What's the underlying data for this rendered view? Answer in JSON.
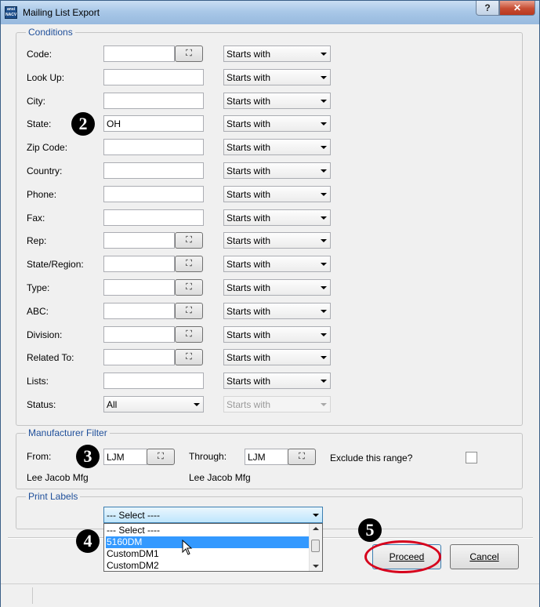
{
  "window": {
    "title": "Mailing List Export",
    "app_icon_text": "ansi NACV",
    "help_glyph": "?",
    "close_glyph": "✕"
  },
  "conditions": {
    "legend": "Conditions",
    "find_glyph": "⛶",
    "rows": [
      {
        "label": "Code:",
        "value": "",
        "has_find": true,
        "operator": "Starts with"
      },
      {
        "label": "Look Up:",
        "value": "",
        "has_find": false,
        "operator": "Starts with"
      },
      {
        "label": "City:",
        "value": "",
        "has_find": false,
        "operator": "Starts with"
      },
      {
        "label": "State:",
        "value": "OH",
        "has_find": false,
        "operator": "Starts with"
      },
      {
        "label": "Zip Code:",
        "value": "",
        "has_find": false,
        "operator": "Starts with"
      },
      {
        "label": "Country:",
        "value": "",
        "has_find": false,
        "operator": "Starts with"
      },
      {
        "label": "Phone:",
        "value": "",
        "has_find": false,
        "operator": "Starts with"
      },
      {
        "label": "Fax:",
        "value": "",
        "has_find": false,
        "operator": "Starts with"
      },
      {
        "label": "Rep:",
        "value": "",
        "has_find": true,
        "operator": "Starts with"
      },
      {
        "label": "State/Region:",
        "value": "",
        "has_find": true,
        "operator": "Starts with"
      },
      {
        "label": "Type:",
        "value": "",
        "has_find": true,
        "operator": "Starts with"
      },
      {
        "label": "ABC:",
        "value": "",
        "has_find": true,
        "operator": "Starts with"
      },
      {
        "label": "Division:",
        "value": "",
        "has_find": true,
        "operator": "Starts with"
      },
      {
        "label": "Related To:",
        "value": "",
        "has_find": true,
        "operator": "Starts with"
      },
      {
        "label": "Lists:",
        "value": "",
        "has_find": false,
        "operator": "Starts with"
      }
    ],
    "status": {
      "label": "Status:",
      "value": "All",
      "operator": "Starts with",
      "operator_disabled": true
    }
  },
  "manufacturer_filter": {
    "legend": "Manufacturer Filter",
    "from_label": "From:",
    "from_value": "LJM",
    "from_name": "Lee Jacob Mfg",
    "through_label": "Through:",
    "through_value": "LJM",
    "through_name": "Lee Jacob Mfg",
    "exclude_label": "Exclude this range?",
    "exclude_checked": false
  },
  "print_labels": {
    "legend": "Print Labels",
    "selected": "--- Select ----",
    "options": [
      "--- Select ----",
      "5160DM",
      "CustomDM1",
      "CustomDM2"
    ],
    "highlighted": "5160DM"
  },
  "buttons": {
    "proceed": "Proceed",
    "cancel": "Cancel"
  },
  "callouts": [
    "2",
    "3",
    "4",
    "5"
  ]
}
